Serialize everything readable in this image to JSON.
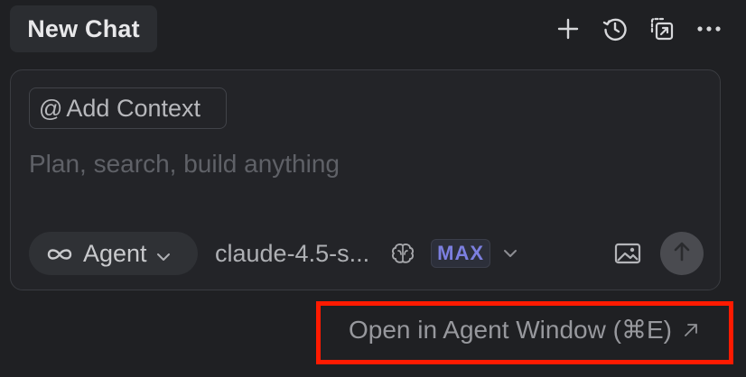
{
  "header": {
    "tab_title": "New Chat",
    "icons": [
      "plus-icon",
      "history-icon",
      "open-in-window-icon",
      "more-icon"
    ]
  },
  "composer": {
    "add_context_symbol": "@",
    "add_context_label": "Add Context",
    "placeholder": "Plan, search, build anything",
    "mode": {
      "label": "Agent",
      "icon": "infinity-icon"
    },
    "model": {
      "label": "claude-4.5-s...",
      "thinking_icon": "brain-icon",
      "badge": "MAX"
    },
    "image_icon": "image-icon",
    "send_icon": "arrow-up-icon"
  },
  "footer": {
    "link_label": "Open in Agent Window (⌘E)",
    "link_icon": "external-arrow-icon",
    "highlight_color": "#ff1a00"
  },
  "colors": {
    "background": "#1f2023",
    "accent_max": "#7c7fe0"
  }
}
